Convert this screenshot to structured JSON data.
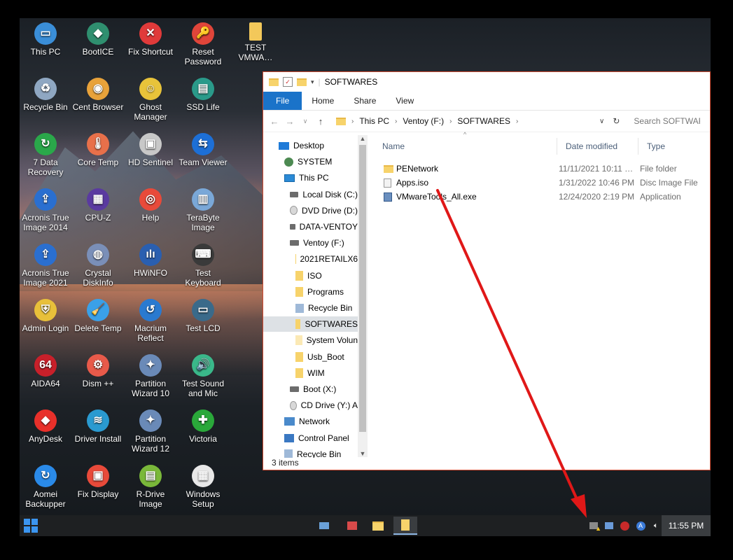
{
  "desktop": {
    "icons": [
      {
        "label": "This PC",
        "color": "#3a8ed8",
        "glyph": "▭"
      },
      {
        "label": "BootICE",
        "color": "#2f8f6f",
        "glyph": "◆"
      },
      {
        "label": "Fix Shortcut",
        "color": "#e03a3a",
        "glyph": "✕"
      },
      {
        "label": "Reset Password",
        "color": "#e0453a",
        "glyph": "🔑"
      },
      {
        "label": "TEST VMWA…",
        "color": "#f3c85a",
        "glyph": ""
      },
      {
        "label": "Recycle Bin",
        "color": "#8fa7c2",
        "glyph": "♻"
      },
      {
        "label": "Cent Browser",
        "color": "#e8a23a",
        "glyph": "◉"
      },
      {
        "label": "Ghost Manager",
        "color": "#e8c33a",
        "glyph": "☺"
      },
      {
        "label": "SSD Life",
        "color": "#2a9a8a",
        "glyph": "▤"
      },
      {
        "label": "7 Data Recovery",
        "color": "#2aa84a",
        "glyph": "↻"
      },
      {
        "label": "Core Temp",
        "color": "#e8704a",
        "glyph": "🌡"
      },
      {
        "label": "HD Sentinel",
        "color": "#c8c8c8",
        "glyph": "▣"
      },
      {
        "label": "Team Viewer",
        "color": "#1d6fd6",
        "glyph": "⇆"
      },
      {
        "label": "Acronis True Image 2014",
        "color": "#2a6fd0",
        "glyph": "⇪"
      },
      {
        "label": "CPU-Z",
        "color": "#5a3aa0",
        "glyph": "▦"
      },
      {
        "label": "Help",
        "color": "#e84a3a",
        "glyph": "◎"
      },
      {
        "label": "TeraByte Image",
        "color": "#7aa8d8",
        "glyph": "▥"
      },
      {
        "label": "Acronis True Image 2021",
        "color": "#2a6fd0",
        "glyph": "⇪"
      },
      {
        "label": "Crystal DiskInfo",
        "color": "#7a8fb8",
        "glyph": "◍"
      },
      {
        "label": "HWiNFO",
        "color": "#2a5fb0",
        "glyph": "ılı"
      },
      {
        "label": "Test Keyboard",
        "color": "#3a3a3a",
        "glyph": "⌨"
      },
      {
        "label": "Admin Login",
        "color": "#e8c03a",
        "glyph": "⛨"
      },
      {
        "label": "Delete Temp",
        "color": "#3aa0e8",
        "glyph": "🧹"
      },
      {
        "label": "Macrium Reflect",
        "color": "#2a7ad0",
        "glyph": "↺"
      },
      {
        "label": "Test LCD",
        "color": "#3a6a8a",
        "glyph": "▭"
      },
      {
        "label": "AIDA64",
        "color": "#c8202a",
        "glyph": "64"
      },
      {
        "label": "Dism ++",
        "color": "#e85a4a",
        "glyph": "⚙"
      },
      {
        "label": "Partition Wizard 10",
        "color": "#6a8ab8",
        "glyph": "✦"
      },
      {
        "label": "Test Sound and Mic",
        "color": "#3ab88a",
        "glyph": "🔊"
      },
      {
        "label": "AnyDesk",
        "color": "#e8302a",
        "glyph": "◆"
      },
      {
        "label": "Driver Install",
        "color": "#2a9ad0",
        "glyph": "≋"
      },
      {
        "label": "Partition Wizard 12",
        "color": "#6a8ab8",
        "glyph": "✦"
      },
      {
        "label": "Victoria",
        "color": "#2aa83a",
        "glyph": "✚"
      },
      {
        "label": "Aomei Backupper",
        "color": "#2a8ae8",
        "glyph": "↻"
      },
      {
        "label": "Fix Display",
        "color": "#e84a3a",
        "glyph": "▣"
      },
      {
        "label": "R-Drive Image",
        "color": "#7ab83a",
        "glyph": "▤"
      },
      {
        "label": "Windows Setup",
        "color": "#e8e8e8",
        "glyph": "▦"
      }
    ]
  },
  "explorer": {
    "title": "SOFTWARES",
    "ribbon": {
      "file": "File",
      "home": "Home",
      "share": "Share",
      "view": "View"
    },
    "breadcrumb": [
      "This PC",
      "Ventoy (F:)",
      "SOFTWARES"
    ],
    "search_placeholder": "Search SOFTWARES",
    "nav": [
      {
        "label": "Desktop",
        "icon": "desktop",
        "indent": 0
      },
      {
        "label": "SYSTEM",
        "icon": "user",
        "indent": 1
      },
      {
        "label": "This PC",
        "icon": "pc",
        "indent": 1
      },
      {
        "label": "Local Disk (C:)",
        "icon": "drive",
        "indent": 2
      },
      {
        "label": "DVD Drive (D:)",
        "icon": "disc",
        "indent": 2
      },
      {
        "label": "DATA-VENTOY",
        "icon": "drive",
        "indent": 2
      },
      {
        "label": "Ventoy (F:)",
        "icon": "drive",
        "indent": 2
      },
      {
        "label": "2021RETAILX6",
        "icon": "folder",
        "indent": 3
      },
      {
        "label": "ISO",
        "icon": "folder",
        "indent": 3
      },
      {
        "label": "Programs",
        "icon": "folder",
        "indent": 3
      },
      {
        "label": "Recycle Bin",
        "icon": "bin",
        "indent": 3
      },
      {
        "label": "SOFTWARES",
        "icon": "folder",
        "indent": 3,
        "selected": true
      },
      {
        "label": "System Volun",
        "icon": "folder-light",
        "indent": 3
      },
      {
        "label": "Usb_Boot",
        "icon": "folder",
        "indent": 3
      },
      {
        "label": "WIM",
        "icon": "folder",
        "indent": 3
      },
      {
        "label": "Boot (X:)",
        "icon": "drive",
        "indent": 2
      },
      {
        "label": "CD Drive (Y:) A",
        "icon": "disc",
        "indent": 2
      },
      {
        "label": "Network",
        "icon": "net",
        "indent": 1
      },
      {
        "label": "Control Panel",
        "icon": "cp",
        "indent": 1
      },
      {
        "label": "Recycle Bin",
        "icon": "bin",
        "indent": 1
      }
    ],
    "columns": {
      "name": "Name",
      "date": "Date modified",
      "type": "Type"
    },
    "files": [
      {
        "name": "PENetwork",
        "date": "11/11/2021 10:11 …",
        "type": "File folder",
        "icon": "folder"
      },
      {
        "name": "Apps.iso",
        "date": "1/31/2022 10:46 PM",
        "type": "Disc Image File",
        "icon": "doc"
      },
      {
        "name": "VMwareTools_All.exe",
        "date": "12/24/2020 2:19 PM",
        "type": "Application",
        "icon": "exe"
      }
    ],
    "status": "3 items"
  },
  "taskbar": {
    "clock": "11:55 PM",
    "apps": [
      "remote-desktop-icon",
      "network-tools-icon",
      "file-explorer-icon",
      "folder-window-icon"
    ],
    "tray": [
      "vmware-tray-warning-icon",
      "network-icon",
      "media-player-icon",
      "accent-icon",
      "volume-icon"
    ]
  },
  "annotation": {
    "color": "#e01818"
  }
}
